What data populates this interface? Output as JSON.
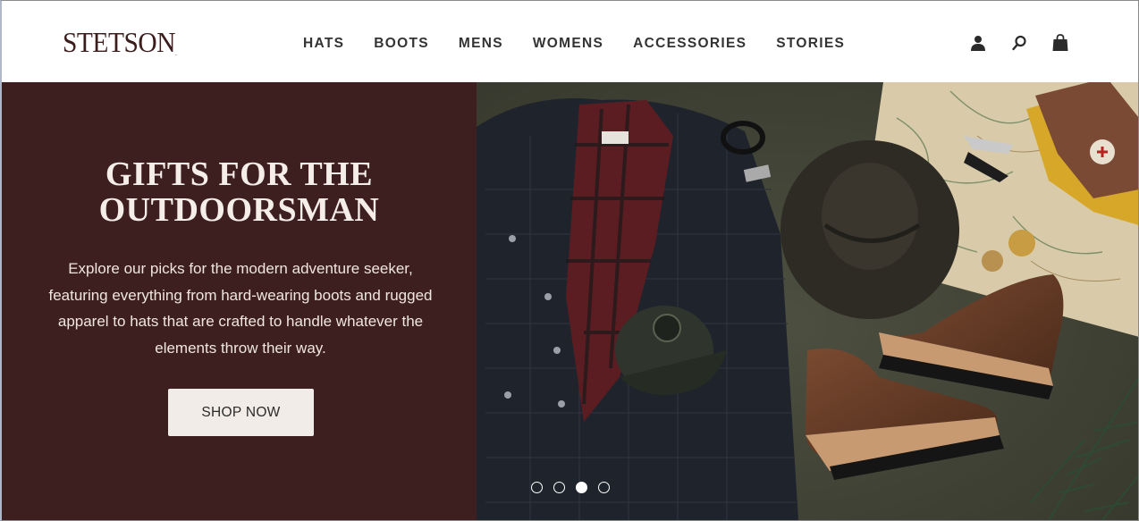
{
  "brand": {
    "logo_text": "STETSON",
    "logo_mark": "."
  },
  "nav": {
    "items": [
      {
        "label": "HATS"
      },
      {
        "label": "BOOTS"
      },
      {
        "label": "MENS"
      },
      {
        "label": "WOMENS"
      },
      {
        "label": "ACCESSORIES"
      },
      {
        "label": "STORIES"
      }
    ]
  },
  "header_icons": [
    {
      "name": "account-icon"
    },
    {
      "name": "search-icon"
    },
    {
      "name": "shopping-bag-icon"
    }
  ],
  "hero": {
    "headline_line1": "GIFTS FOR THE",
    "headline_line2": "OUTDOORSMAN",
    "body": "Explore our picks for the modern adventure seeker, featuring everything from hard-wearing boots and rugged apparel to hats that are crafted to handle whatever the elements throw their way.",
    "cta_label": "SHOP NOW",
    "slides_total": 4,
    "active_slide": 3
  },
  "colors": {
    "brand_maroon": "#3e1f1f",
    "logo": "#3d1c1c",
    "cta_bg": "#f1ece8",
    "nav_text": "#333333"
  }
}
